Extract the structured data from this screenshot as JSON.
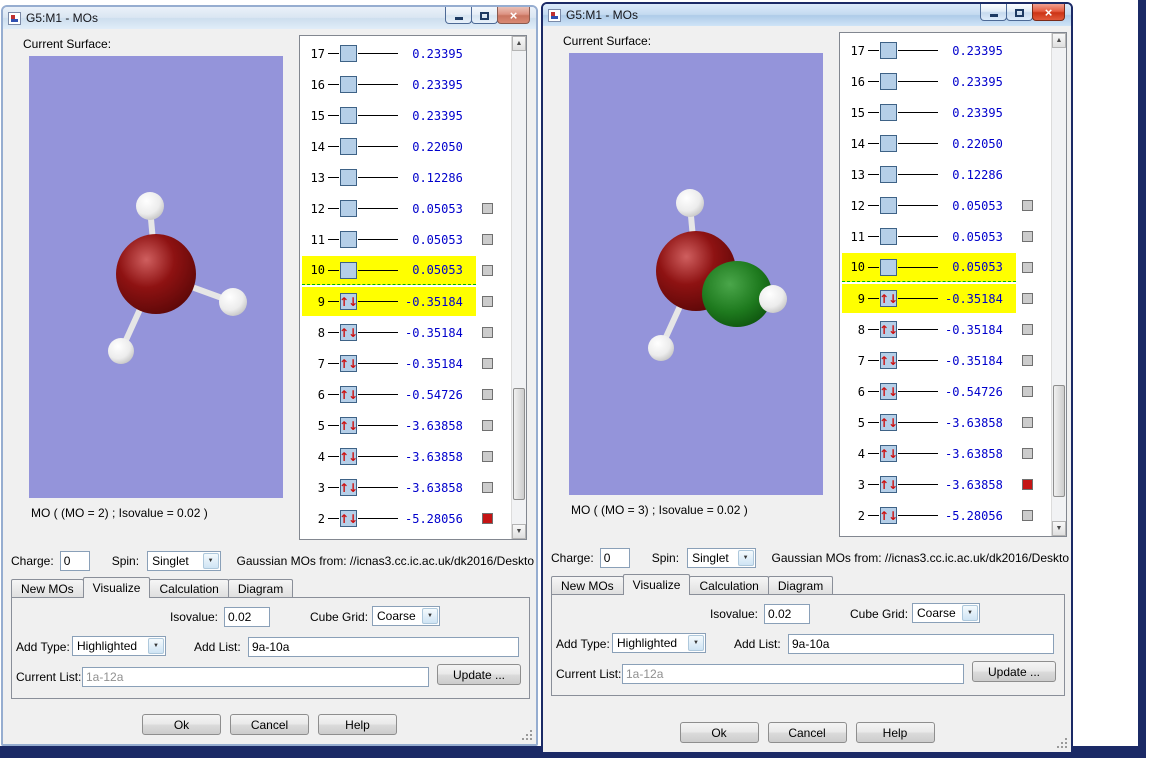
{
  "windows": [
    {
      "title": "G5:M1 - MOs",
      "caption": "MO ( (MO = 2) ; Isovalue = 0.02 )",
      "active": false,
      "show_mo_surface": false,
      "red_checkbox_mo": 2
    },
    {
      "title": "G5:M1 - MOs",
      "caption": "MO ( (MO = 3) ; Isovalue = 0.02 )",
      "active": true,
      "show_mo_surface": true,
      "red_checkbox_mo": 3
    }
  ],
  "labels": {
    "current_surface": "Current Surface:",
    "charge": "Charge:",
    "spin": "Spin:",
    "mos_from": "Gaussian MOs from:  //icnas3.cc.ic.ac.uk/dk2016/Deskto"
  },
  "controls": {
    "charge_value": "0",
    "spin_value": "Singlet",
    "tabs": [
      "New MOs",
      "Visualize",
      "Calculation",
      "Diagram"
    ],
    "active_tab": "Visualize",
    "isovalue_label": "Isovalue:",
    "isovalue_value": "0.02",
    "cube_grid_label": "Cube Grid:",
    "cube_grid_value": "Coarse",
    "add_type_label": "Add Type:",
    "add_type_value": "Highlighted",
    "add_list_label": "Add List:",
    "add_list_value": "9a-10a",
    "current_list_label": "Current List:",
    "current_list_value": "1a-12a",
    "update_button": "Update ...",
    "ok_button": "Ok",
    "cancel_button": "Cancel",
    "help_button": "Help"
  },
  "mo_list": {
    "rows": [
      {
        "mo": 17,
        "energy": "0.23395",
        "occupied": false,
        "checkbox": false,
        "highlighted": false,
        "separator_below": false
      },
      {
        "mo": 16,
        "energy": "0.23395",
        "occupied": false,
        "checkbox": false,
        "highlighted": false,
        "separator_below": false
      },
      {
        "mo": 15,
        "energy": "0.23395",
        "occupied": false,
        "checkbox": false,
        "highlighted": false,
        "separator_below": false
      },
      {
        "mo": 14,
        "energy": "0.22050",
        "occupied": false,
        "checkbox": false,
        "highlighted": false,
        "separator_below": false
      },
      {
        "mo": 13,
        "energy": "0.12286",
        "occupied": false,
        "checkbox": false,
        "highlighted": false,
        "separator_below": false
      },
      {
        "mo": 12,
        "energy": "0.05053",
        "occupied": false,
        "checkbox": true,
        "highlighted": false,
        "separator_below": false
      },
      {
        "mo": 11,
        "energy": "0.05053",
        "occupied": false,
        "checkbox": true,
        "highlighted": false,
        "separator_below": false
      },
      {
        "mo": 10,
        "energy": "0.05053",
        "occupied": false,
        "checkbox": true,
        "highlighted": true,
        "separator_below": true
      },
      {
        "mo": 9,
        "energy": "-0.35184",
        "occupied": true,
        "checkbox": true,
        "highlighted": true,
        "separator_below": false
      },
      {
        "mo": 8,
        "energy": "-0.35184",
        "occupied": true,
        "checkbox": true,
        "highlighted": false,
        "separator_below": false
      },
      {
        "mo": 7,
        "energy": "-0.35184",
        "occupied": true,
        "checkbox": true,
        "highlighted": false,
        "separator_below": false
      },
      {
        "mo": 6,
        "energy": "-0.54726",
        "occupied": true,
        "checkbox": true,
        "highlighted": false,
        "separator_below": false
      },
      {
        "mo": 5,
        "energy": "-3.63858",
        "occupied": true,
        "checkbox": true,
        "highlighted": false,
        "separator_below": false
      },
      {
        "mo": 4,
        "energy": "-3.63858",
        "occupied": true,
        "checkbox": true,
        "highlighted": false,
        "separator_below": false
      },
      {
        "mo": 3,
        "energy": "-3.63858",
        "occupied": true,
        "checkbox": true,
        "highlighted": false,
        "separator_below": false
      },
      {
        "mo": 2,
        "energy": "-5.28056",
        "occupied": true,
        "checkbox": true,
        "highlighted": false,
        "separator_below": false
      }
    ]
  },
  "icons": {
    "close": "×",
    "scroll_up": "▲",
    "scroll_down": "▼",
    "dropdown": "▼",
    "spin_up": "↑",
    "spin_down": "↓"
  },
  "colors": {
    "highlight": "#ffff00",
    "energy_text": "#0000cc",
    "canvas": "#9494da",
    "selected_checkbox": "#c41414",
    "homo_lumo_separator": "#00b400",
    "oxygen_sphere": "#8e1212",
    "hydrogen_sphere": "#ffffff",
    "mo_surface": "#1e7a1e"
  }
}
